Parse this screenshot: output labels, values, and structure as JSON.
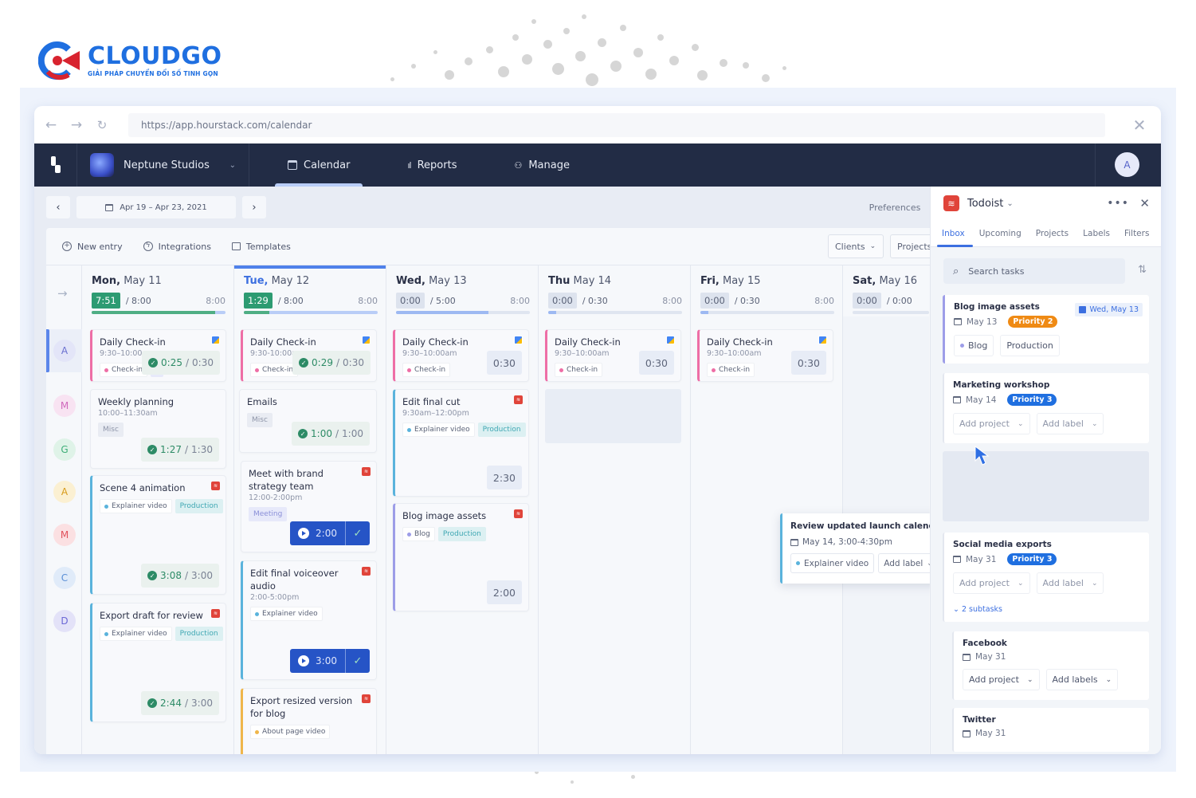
{
  "branding": {
    "name": "CLOUDGO",
    "tagline": "GIẢI PHÁP CHUYỂN ĐỔI SỐ TINH GỌN"
  },
  "browser": {
    "url": "https://app.hourstack.com/calendar",
    "back_icon": "arrow-left",
    "forward_icon": "arrow-right",
    "reload_icon": "reload",
    "close_icon": "close"
  },
  "appbar": {
    "workspace": "Neptune Studios",
    "nav": [
      {
        "label": "Calendar",
        "icon": "calendar-icon",
        "active": true
      },
      {
        "label": "Reports",
        "icon": "bar-chart-icon",
        "active": false
      },
      {
        "label": "Manage",
        "icon": "people-icon",
        "active": false
      }
    ],
    "user_initial": "A"
  },
  "datebar": {
    "range": "Apr 19 – Apr 23, 2021",
    "preferences": "Preferences"
  },
  "toolbar": {
    "new_entry": "New entry",
    "integrations": "Integrations",
    "templates": "Templates",
    "clients": "Clients",
    "projects": "Projects"
  },
  "colors": {
    "accent": "#3c6fe0",
    "done_green": "#2d9b72",
    "priority2": "#ef8a14",
    "priority3": "#1f6fe0",
    "todoist_red": "#e0443a"
  },
  "team": [
    {
      "initial": "A",
      "bg": "#e3e5f8",
      "fg": "#6a70d0",
      "active": true
    },
    {
      "initial": "M",
      "bg": "#f8e3f2",
      "fg": "#d06abd"
    },
    {
      "initial": "G",
      "bg": "#dff3e8",
      "fg": "#3fae78"
    },
    {
      "initial": "A",
      "bg": "#fbf0d2",
      "fg": "#d79a18"
    },
    {
      "initial": "M",
      "bg": "#fbe0e2",
      "fg": "#e0525c"
    },
    {
      "initial": "C",
      "bg": "#e0ebf9",
      "fg": "#5a8fd6"
    },
    {
      "initial": "D",
      "bg": "#e3e2f8",
      "fg": "#6b68d6"
    }
  ],
  "days": [
    {
      "day": "Mon,",
      "date": "May 11",
      "tracked": "7:51",
      "planned": "8:00",
      "cap": "8:00",
      "progress": 0.92,
      "tracked_style": "green"
    },
    {
      "day": "Tue,",
      "date": "May 12",
      "tracked": "1:29",
      "planned": "8:00",
      "cap": "8:00",
      "progress": 0.19,
      "tracked_style": "green",
      "today": true
    },
    {
      "day": "Wed,",
      "date": "May 13",
      "tracked": "0:00",
      "planned": "5:00",
      "cap": "8:00",
      "progress": 0.69,
      "tracked_style": "grey"
    },
    {
      "day": "Thu",
      "date": "May 14",
      "tracked": "0:00",
      "planned": "0:30",
      "cap": "8:00",
      "progress": 0.06,
      "tracked_style": "grey"
    },
    {
      "day": "Fri,",
      "date": "May 15",
      "tracked": "0:00",
      "planned": "0:30",
      "cap": "8:00",
      "progress": 0.06,
      "tracked_style": "grey"
    },
    {
      "day": "Sat,",
      "date": "May 16",
      "tracked": "0:00",
      "planned": "0:00",
      "cap": "",
      "progress": 0,
      "tracked_style": "grey"
    }
  ],
  "entries": {
    "mon": [
      {
        "title": "Daily Check-in",
        "time": "9:30–10:00am",
        "tags": [
          "Check-in",
          "M"
        ],
        "tracked": "0:25",
        "planned": "0:30",
        "source": "google-calendar"
      },
      {
        "title": "Weekly planning",
        "time": "10:00–11:30am",
        "tags": [
          "Misc"
        ],
        "tracked": "1:27",
        "planned": "1:30"
      },
      {
        "title": "Scene 4 animation",
        "tags": [
          "Explainer video",
          "Production"
        ],
        "tracked": "3:08",
        "planned": "3:00",
        "source": "todoist"
      },
      {
        "title": "Export draft for review",
        "tags": [
          "Explainer video",
          "Production"
        ],
        "tracked": "2:44",
        "planned": "3:00",
        "source": "todoist"
      }
    ],
    "tue": [
      {
        "title": "Daily Check-in",
        "time": "9:30-10:00am",
        "tags": [
          "Check-in"
        ],
        "tracked": "0:29",
        "planned": "0:30",
        "source": "google-calendar"
      },
      {
        "title": "Emails",
        "tags": [
          "Misc"
        ],
        "tracked": "1:00",
        "planned": "1:00"
      },
      {
        "title": "Meet with brand strategy team",
        "time": "12:00-2:00pm",
        "tags": [
          "Meeting"
        ],
        "timer": "2:00",
        "source": "todoist"
      },
      {
        "title": "Edit final voiceover audio",
        "time": "2:00-5:00pm",
        "tags": [
          "Explainer video"
        ],
        "timer": "3:00",
        "source": "todoist"
      },
      {
        "title": "Export resized version for blog",
        "tags": [
          "About page video"
        ],
        "source": "todoist"
      }
    ],
    "wed": [
      {
        "title": "Daily Check-in",
        "time": "9:30–10:00am",
        "tags": [
          "Check-in"
        ],
        "duration": "0:30",
        "source": "google-calendar"
      },
      {
        "title": "Edit final cut",
        "time": "9:30am–12:00pm",
        "tags": [
          "Explainer video",
          "Production"
        ],
        "duration": "2:30",
        "source": "todoist"
      },
      {
        "title": "Blog image assets",
        "tags": [
          "Blog",
          "Production"
        ],
        "duration": "2:00",
        "source": "todoist"
      }
    ],
    "thu": [
      {
        "title": "Daily Check-in",
        "time": "9:30–10:00am",
        "tags": [
          "Check-in"
        ],
        "duration": "0:30",
        "source": "google-calendar"
      }
    ],
    "fri": [
      {
        "title": "Daily Check-in",
        "time": "9:30–10:00am",
        "tags": [
          "Check-in"
        ],
        "duration": "0:30",
        "source": "google-calendar"
      }
    ]
  },
  "drag_popup": {
    "title": "Review updated launch calendar",
    "date": "May 14, 3:00-4:30pm",
    "project": "Explainer video",
    "add_label": "Add label"
  },
  "todoist": {
    "title": "Todoist",
    "tabs": [
      "Inbox",
      "Upcoming",
      "Projects",
      "Labels",
      "Filters"
    ],
    "search_placeholder": "Search tasks",
    "tasks": [
      {
        "title": "Blog image assets",
        "date": "May 13",
        "priority": "Priority 2",
        "scheduled": "Wed, May 13",
        "project": "Blog",
        "label": "Production"
      },
      {
        "title": "Marketing workshop",
        "date": "May 14",
        "priority": "Priority 3",
        "add_project": "Add project",
        "add_label": "Add label"
      },
      {
        "title": "Social media exports",
        "date": "May 31",
        "priority": "Priority 3",
        "add_project": "Add project",
        "add_label": "Add label",
        "subtasks": "2 subtasks"
      },
      {
        "title": "Facebook",
        "date": "May 31",
        "add_project": "Add project",
        "add_label": "Add labels"
      },
      {
        "title": "Twitter",
        "date": "May 31"
      }
    ]
  }
}
